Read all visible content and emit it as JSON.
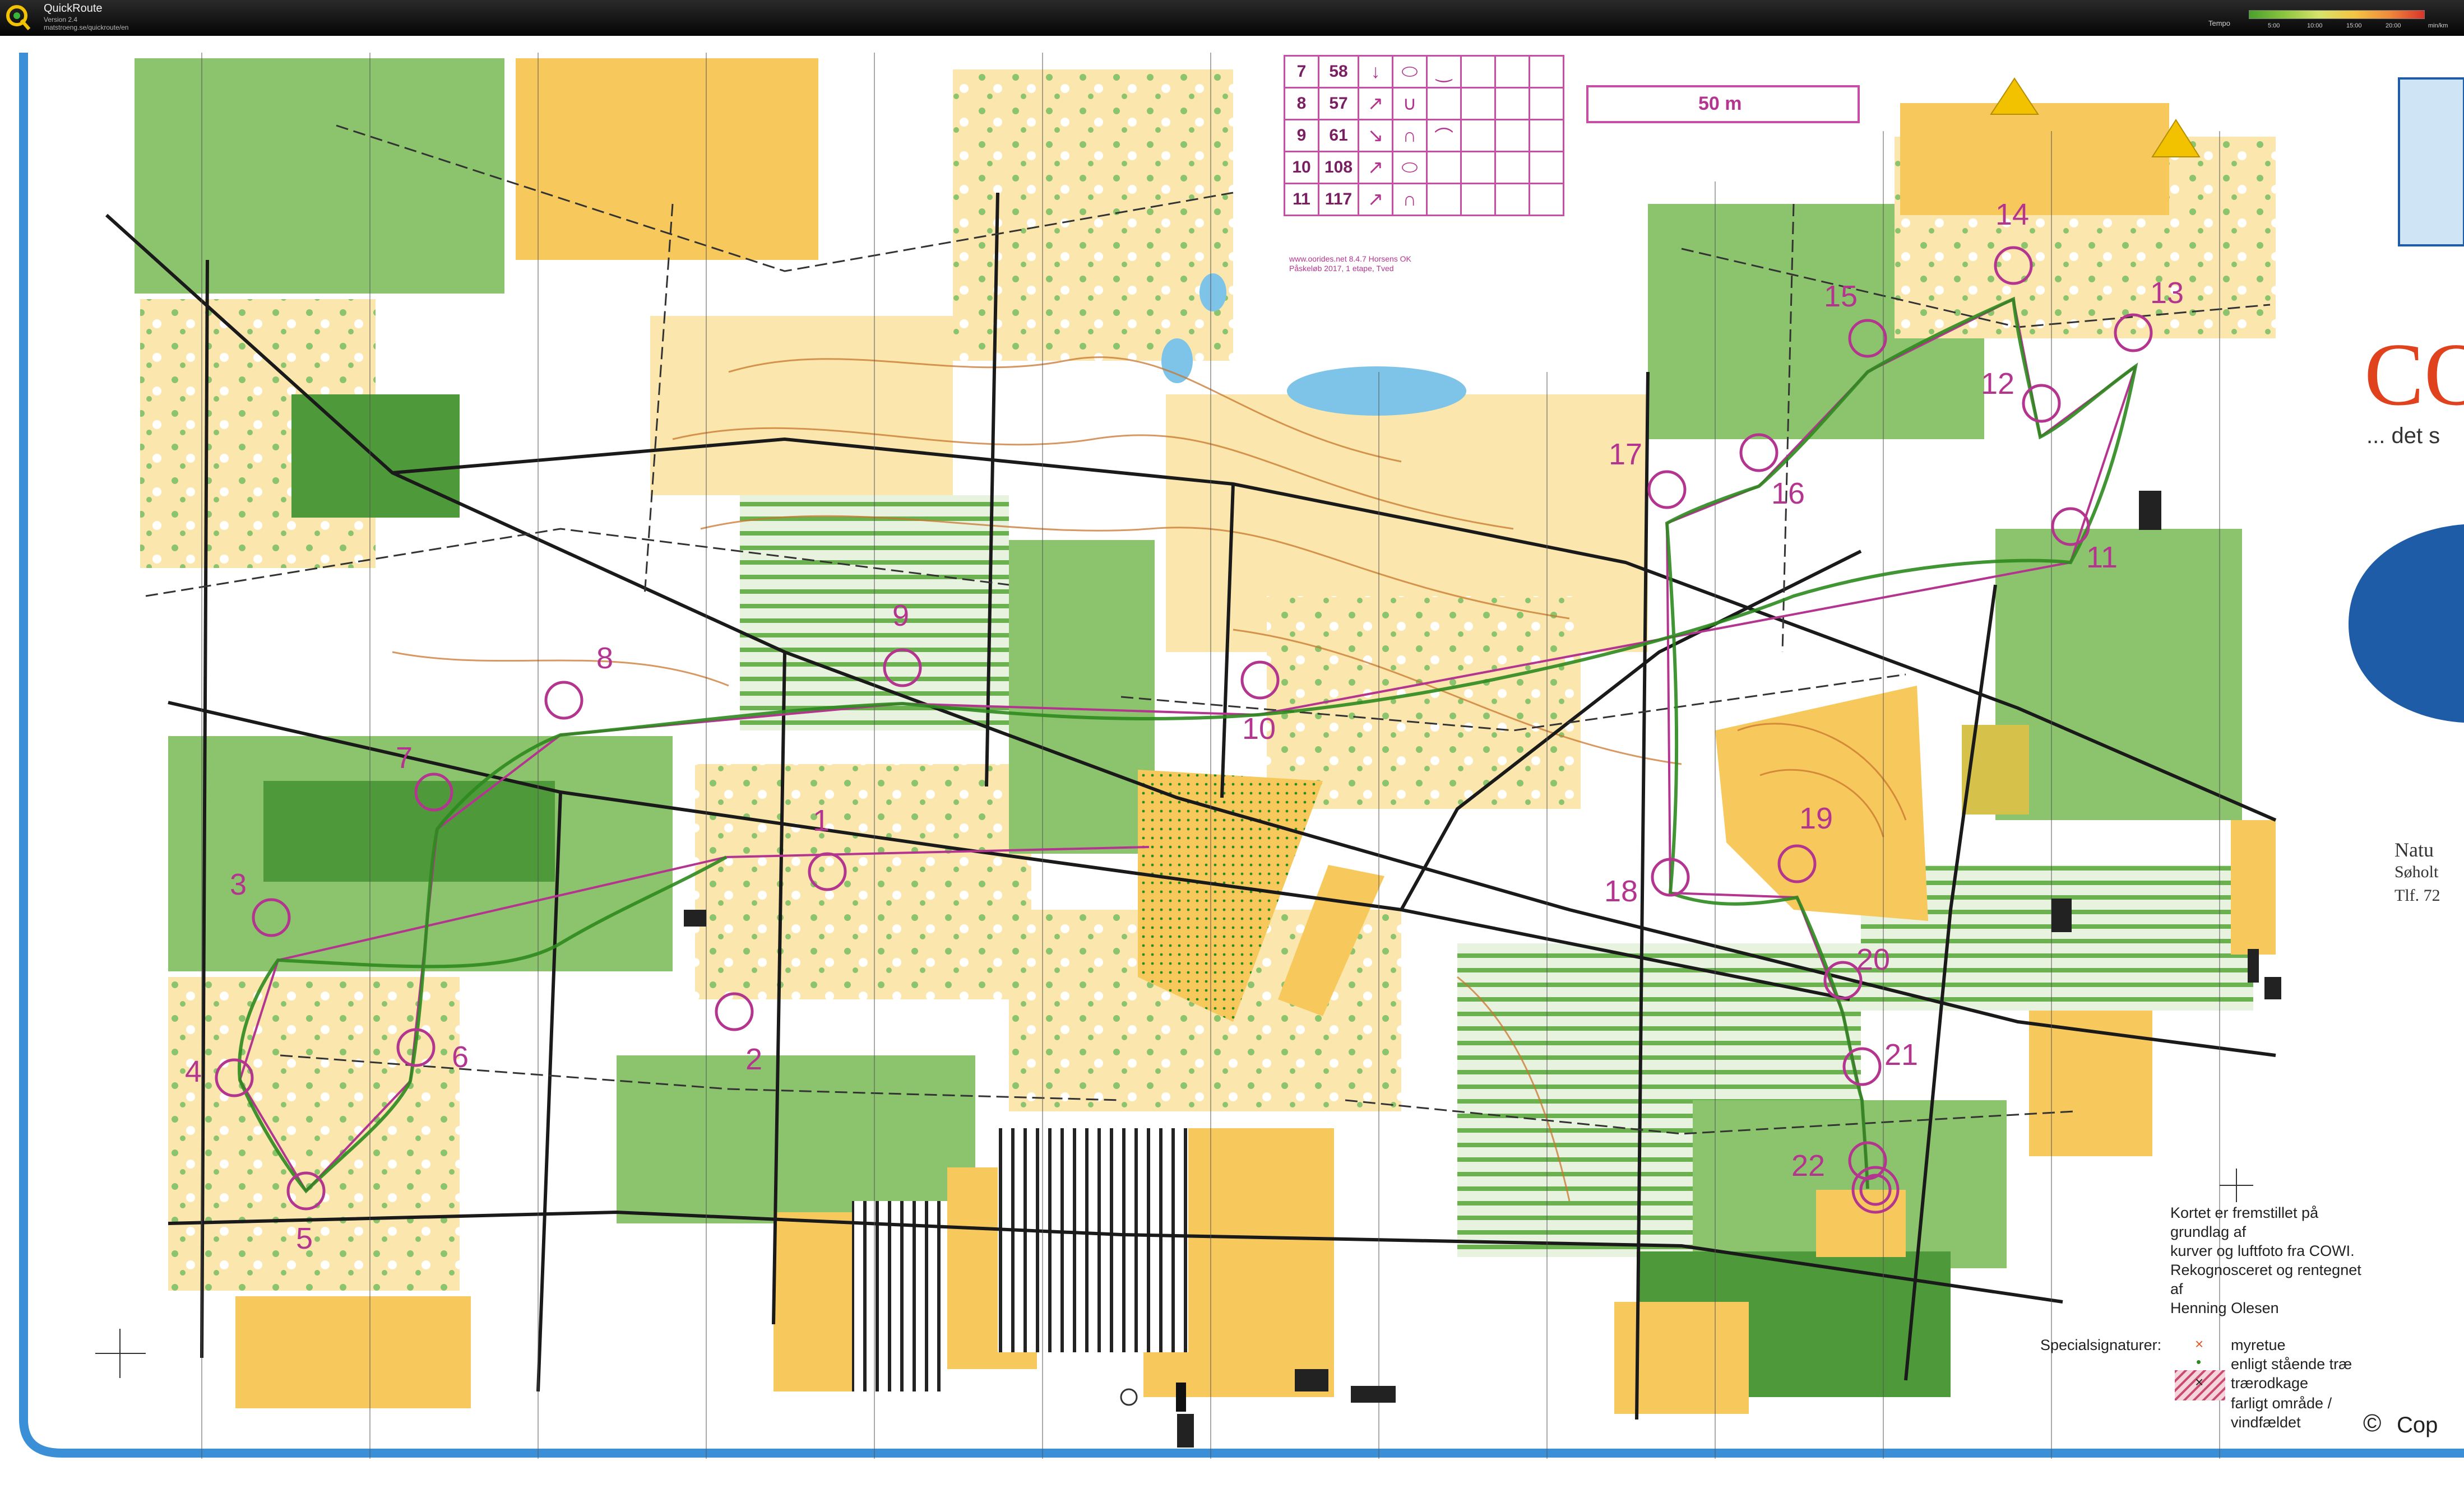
{
  "app": {
    "name": "QuickRoute",
    "version": "Version 2.4",
    "url": "matstroeng.se/quickroute/en",
    "logo_icon": "quickroute-logo-icon"
  },
  "speed_legend": {
    "label": "Tempo",
    "ticks": [
      "5:00",
      "10:00",
      "15:00",
      "20:00"
    ],
    "unit": "min/km"
  },
  "course": {
    "color": "#b4358f",
    "route_color": "#2d8a1f",
    "controls": [
      "1",
      "2",
      "3",
      "4",
      "5",
      "6",
      "7",
      "8",
      "9",
      "10",
      "11",
      "12",
      "13",
      "14",
      "15",
      "16",
      "17",
      "18",
      "19",
      "20",
      "21",
      "22"
    ],
    "start_icon": "start-triangle-icon",
    "finish_icon": "finish-double-circle-icon"
  },
  "description_sheet": {
    "rows": [
      {
        "num": "7",
        "code": "58",
        "dir": "↓",
        "feature": "⬭",
        "detail": "‿"
      },
      {
        "num": "8",
        "code": "57",
        "dir": "↗",
        "feature": "∪",
        "detail": ""
      },
      {
        "num": "9",
        "code": "61",
        "dir": "↘",
        "feature": "∩",
        "detail": "⌒"
      },
      {
        "num": "10",
        "code": "108",
        "dir": "↗",
        "feature": "⬭",
        "detail": ""
      },
      {
        "num": "11",
        "code": "117",
        "dir": "↗",
        "feature": "∩",
        "detail": ""
      }
    ],
    "footer_line1": "www.oorides.net 8.4.7 Horsens OK",
    "footer_line2": "Påskeløb 2017, 1 etape, Tved"
  },
  "scale_bar": {
    "label": "50 m"
  },
  "sponsor": {
    "letters": "CO",
    "tagline": "... det s"
  },
  "natur": {
    "title": "Natu",
    "line1": "Søholt",
    "line2": "Tlf. 72"
  },
  "credits": {
    "lines": [
      "Kortet er fremstillet på grundlag af",
      "kurver og luftfoto fra COWI.",
      "Rekognosceret og rentegnet af",
      "Henning Olesen"
    ]
  },
  "special_symbols": {
    "title": "Specialsignaturer:",
    "items": [
      {
        "symbol": "×",
        "color": "#e2572a",
        "label": "myretue"
      },
      {
        "symbol": "•",
        "color": "#2d8a1f",
        "label": "enligt stående træ"
      },
      {
        "symbol": "×",
        "color": "#222222",
        "label": "trærodkage"
      },
      {
        "symbol": "▩",
        "color": "#c94a6e",
        "label": "farligt område /"
      },
      {
        "symbol": "",
        "color": "#c94a6e",
        "label": "vindfældet"
      }
    ]
  },
  "copyright": {
    "symbol": "©",
    "text": "Cop"
  },
  "colors": {
    "open_land": "#f7c85b",
    "rough_open": "#fbe7ad",
    "forest_green": "#8bc46c",
    "dense_green": "#4e9a3a",
    "contour_brown": "#c9762e",
    "water": "#7ec3e8",
    "border_blue": "#3b8fd6"
  }
}
